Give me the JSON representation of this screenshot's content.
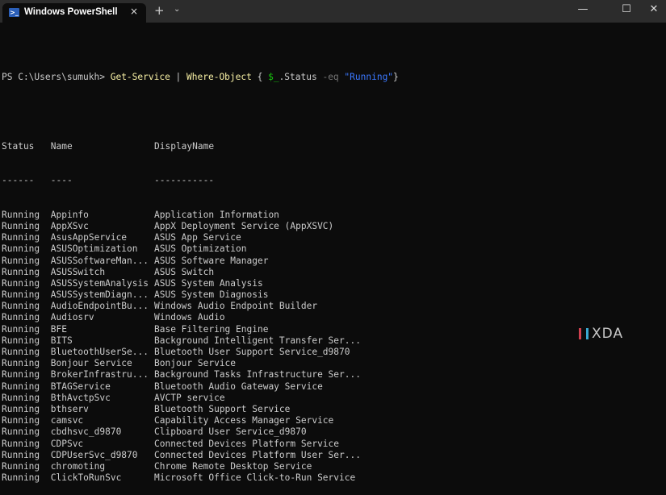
{
  "window": {
    "tab_title": "Windows PowerShell",
    "tab_icon": "powershell-icon",
    "close_tab": "×",
    "new_tab": "+",
    "dropdown": "⌄",
    "minimize": "—",
    "maximize": "☐",
    "close": "✕"
  },
  "command": {
    "prompt": "PS C:\\Users\\sumukh> ",
    "cmdlet": "Get-Service",
    "pipe": " | ",
    "filter": "Where-Object",
    "brace_open": " { ",
    "var": "$_",
    "prop": ".Status ",
    "op": "-eq",
    "space": " ",
    "value": "\"Running\"",
    "brace_close": "}"
  },
  "headers": [
    "Status",
    "Name",
    "DisplayName"
  ],
  "underlines": [
    "------",
    "----",
    "-----------"
  ],
  "rows": [
    [
      "Running",
      "Appinfo",
      "Application Information"
    ],
    [
      "Running",
      "AppXSvc",
      "AppX Deployment Service (AppXSVC)"
    ],
    [
      "Running",
      "AsusAppService",
      "ASUS App Service"
    ],
    [
      "Running",
      "ASUSOptimization",
      "ASUS Optimization"
    ],
    [
      "Running",
      "ASUSSoftwareMan...",
      "ASUS Software Manager"
    ],
    [
      "Running",
      "ASUSSwitch",
      "ASUS Switch"
    ],
    [
      "Running",
      "ASUSSystemAnalysis",
      "ASUS System Analysis"
    ],
    [
      "Running",
      "ASUSSystemDiagn...",
      "ASUS System Diagnosis"
    ],
    [
      "Running",
      "AudioEndpointBu...",
      "Windows Audio Endpoint Builder"
    ],
    [
      "Running",
      "Audiosrv",
      "Windows Audio"
    ],
    [
      "Running",
      "BFE",
      "Base Filtering Engine"
    ],
    [
      "Running",
      "BITS",
      "Background Intelligent Transfer Ser..."
    ],
    [
      "Running",
      "BluetoothUserSe...",
      "Bluetooth User Support Service_d9870"
    ],
    [
      "Running",
      "Bonjour Service",
      "Bonjour Service"
    ],
    [
      "Running",
      "BrokerInfrastru...",
      "Background Tasks Infrastructure Ser..."
    ],
    [
      "Running",
      "BTAGService",
      "Bluetooth Audio Gateway Service"
    ],
    [
      "Running",
      "BthAvctpSvc",
      "AVCTP service"
    ],
    [
      "Running",
      "bthserv",
      "Bluetooth Support Service"
    ],
    [
      "Running",
      "camsvc",
      "Capability Access Manager Service"
    ],
    [
      "Running",
      "cbdhsvc_d9870",
      "Clipboard User Service_d9870"
    ],
    [
      "Running",
      "CDPSvc",
      "Connected Devices Platform Service"
    ],
    [
      "Running",
      "CDPUserSvc_d9870",
      "Connected Devices Platform User Ser..."
    ],
    [
      "Running",
      "chromoting",
      "Chrome Remote Desktop Service"
    ],
    [
      "Running",
      "ClickToRunSvc",
      "Microsoft Office Click-to-Run Service"
    ]
  ],
  "watermark": "XDA"
}
